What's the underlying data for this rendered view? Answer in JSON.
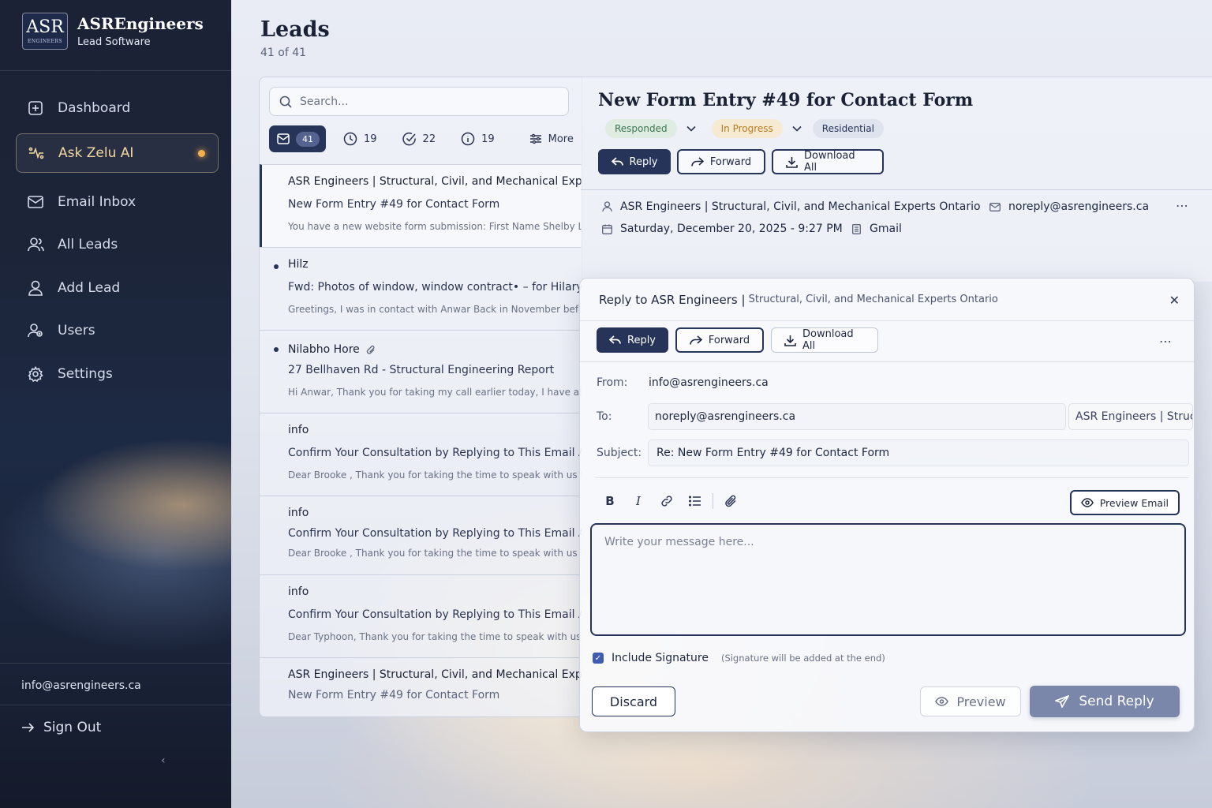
{
  "brand": {
    "logo_text": "ASR",
    "logo_sub": "ENGINEERS",
    "name": "ASREngineers",
    "subtitle": "Lead Software"
  },
  "sidebar": {
    "items": [
      {
        "label": "Dashboard",
        "icon": "dashboard-icon"
      },
      {
        "label": "Ask Zelu AI",
        "icon": "ai-sparkle-icon",
        "active": true
      },
      {
        "label": "Email Inbox",
        "icon": "mail-icon"
      },
      {
        "label": "All Leads",
        "icon": "users-icon"
      },
      {
        "label": "Add Lead",
        "icon": "user-add-icon"
      },
      {
        "label": "Users",
        "icon": "user-group-icon"
      },
      {
        "label": "Settings",
        "icon": "gear-icon"
      }
    ],
    "account_email": "info@asrengineers.ca",
    "sign_out": "Sign Out",
    "collapse_glyph": "‹"
  },
  "header": {
    "title": "Leads",
    "count": "41 of 41"
  },
  "list": {
    "search_placeholder": "Search...",
    "filters": [
      {
        "icon": "inbox-icon",
        "count": "41",
        "active": true
      },
      {
        "icon": "clock-icon",
        "count": "19"
      },
      {
        "icon": "check-circle-icon",
        "count": "22"
      },
      {
        "icon": "info-icon",
        "count": "19"
      }
    ],
    "more_label": "More",
    "items": [
      {
        "sender": "ASR Engineers | Structural, Civil, and Mechanical Experts Ontario",
        "subject": "New Form Entry #49 for Contact Form",
        "preview": "You have a new website form submission: First Name Shelby Last",
        "selected": true,
        "unread": false,
        "attachment": false
      },
      {
        "sender": "Hilz",
        "subject": "Fwd: Photos of window, window contract• – for Hilary",
        "preview": "Greetings, I was in contact with Anwar Back in November before",
        "unread": true,
        "attachment": false
      },
      {
        "sender": "Nilabho Hore",
        "subject": "27 Bellhaven Rd - Structural Engineering Report",
        "preview": "Hi Anwar, Thank you for taking my call earlier today, I have also",
        "unread": true,
        "attachment": true
      },
      {
        "sender": "info",
        "subject": "Confirm Your Consultation by Replying to This Email ASR",
        "preview": "Dear Brooke , Thank you for taking the time to speak with us to",
        "unread": false,
        "attachment": false
      },
      {
        "sender": "info",
        "subject": "Confirm Your Consultation by Replying to This Email ASR",
        "preview": "Dear Brooke , Thank you for taking the time to speak with us to",
        "unread": false,
        "attachment": false
      },
      {
        "sender": "info",
        "subject": "Confirm Your Consultation by Replying to This Email ASR",
        "preview": "Dear Typhoon, Thank you for taking the time to speak with us to",
        "unread": false,
        "attachment": false
      },
      {
        "sender": "ASR Engineers | Structural, Civil, and Mechanical Experts Ontario",
        "subject": "New Form Entry #49 for Contact Form",
        "preview": "",
        "unread": false,
        "attachment": false
      }
    ]
  },
  "detail": {
    "title": "New Form Entry #49 for Contact Form",
    "status": "Responded",
    "progress": "In Progress",
    "category": "Residential",
    "reply_label": "Reply",
    "forward_label": "Forward",
    "download_label": "Download All",
    "sender_name": "ASR Engineers | Structural, Civil, and Mechanical Experts Ontario",
    "sender_email": "noreply@asrengineers.ca",
    "date": "Saturday, December 20, 2025 - 9:27 PM",
    "source": "Gmail",
    "kebab": "⋯"
  },
  "reply": {
    "title_main": "Reply to ASR Engineers |",
    "title_sub": "Structural, Civil, and Mechanical Experts Ontario",
    "close": "✕",
    "reply_label": "Reply",
    "forward_label": "Forward",
    "download_label": "Download All",
    "kebab": "⋯",
    "from_label": "From:",
    "from_value": "info@asrengineers.ca",
    "to_label": "To:",
    "to_value": "noreply@asrengineers.ca",
    "to_name": "ASR Engineers | Structural, Civil, and Mechanical Experts Ontario",
    "subject_label": "Subject:",
    "subject_value": "Re: New Form Entry #49 for Contact Form",
    "toolbar": {
      "bold": "B",
      "italic": "I"
    },
    "preview_email_label": "Preview Email",
    "message_placeholder": "Write your message here...",
    "include_signature": "Include Signature",
    "signature_checked": true,
    "signature_note": "(Signature will be added at the end)",
    "discard_label": "Discard",
    "preview_label": "Preview",
    "send_label": "Send Reply"
  },
  "colors": {
    "navy": "#26345a",
    "sidebar": "#1c2438",
    "accent_gold": "#f3b04c",
    "chip_green": "#3d7552",
    "chip_orange": "#b57c22",
    "send_button": "#7b87aa"
  }
}
